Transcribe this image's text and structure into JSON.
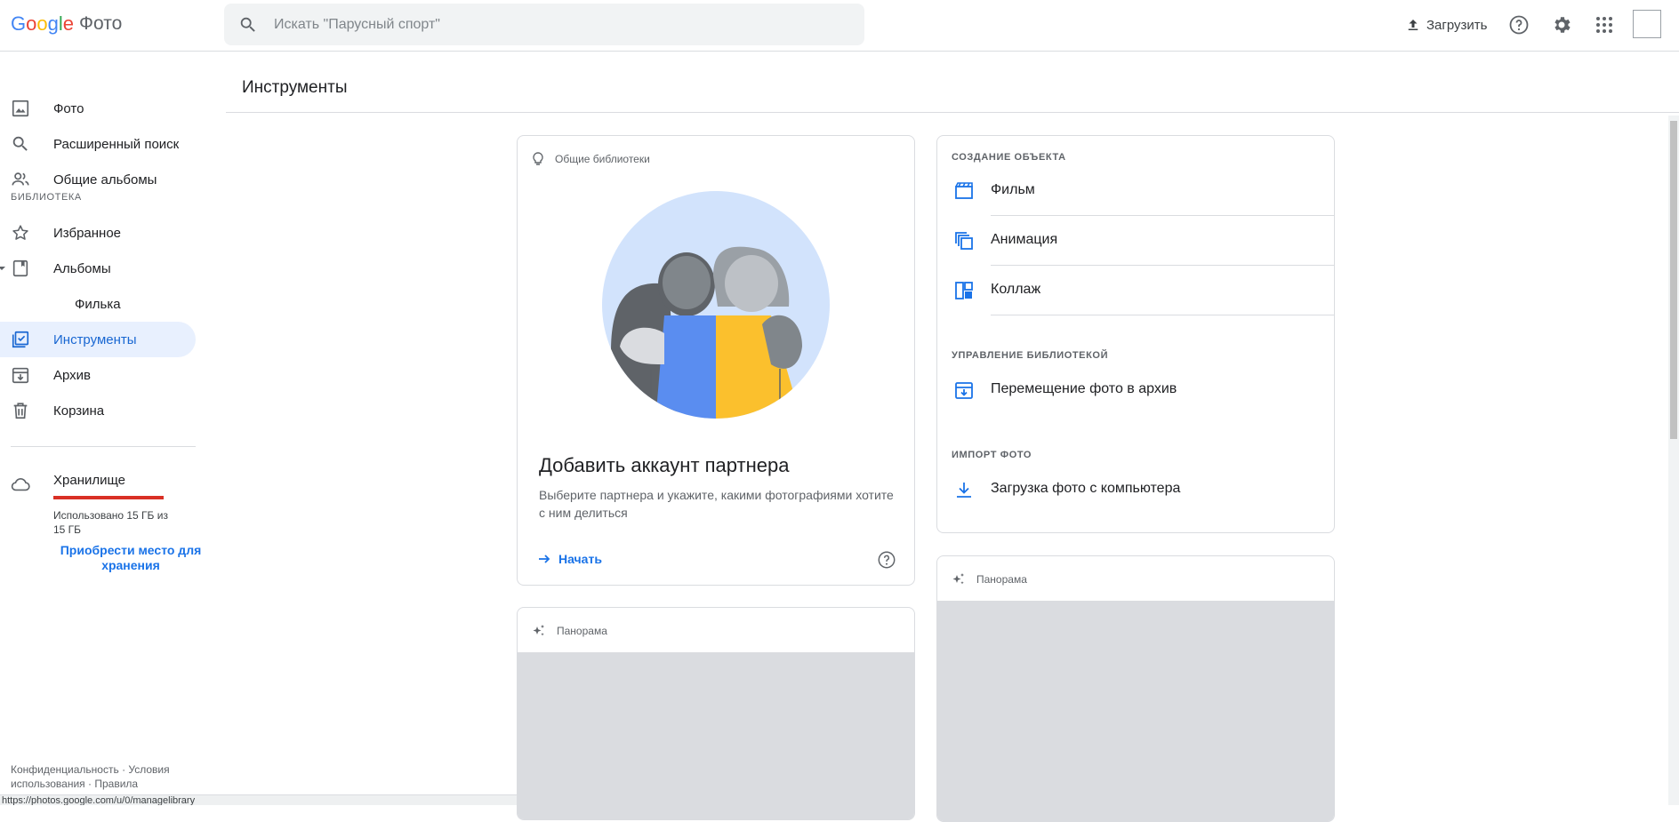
{
  "header": {
    "logo_google": "Google",
    "logo_product": "Фото",
    "search_placeholder": "Искать \"Парусный спорт\"",
    "upload_label": "Загрузить"
  },
  "sidebar": {
    "items": [
      {
        "label": "Фото",
        "icon": "photo-icon"
      },
      {
        "label": "Расширенный поиск",
        "icon": "search-icon"
      },
      {
        "label": "Общие альбомы",
        "icon": "people-icon"
      }
    ],
    "library_heading": "БИБЛИОТЕКА",
    "library_items": [
      {
        "label": "Избранное",
        "icon": "star-icon"
      },
      {
        "label": "Альбомы",
        "icon": "album-icon"
      },
      {
        "label": "Филька"
      },
      {
        "label": "Инструменты",
        "icon": "tools-icon",
        "active": true
      },
      {
        "label": "Архив",
        "icon": "archive-icon"
      },
      {
        "label": "Корзина",
        "icon": "trash-icon"
      }
    ],
    "storage": {
      "title": "Хранилище",
      "used": "Использовано 15 ГБ из 15 ГБ",
      "buy": "Приобрести место для хранения",
      "fill_fraction": 1.0
    },
    "footer": {
      "privacy": "Конфиденциальность",
      "sep": "·",
      "terms": "Условия использования",
      "policy": "Правила"
    }
  },
  "status_url": "https://photos.google.com/u/0/managelibrary",
  "main": {
    "title": "Инструменты",
    "partner_card": {
      "header": "Общие библиотеки",
      "title": "Добавить аккаунт партнера",
      "description": "Выберите партнера и укажите, какими фотографиями хотите с ним делиться",
      "start": "Начать"
    },
    "panorama_left": {
      "header": "Панорама"
    },
    "panorama_right": {
      "header": "Панорама"
    },
    "tools_card": {
      "create_heading": "СОЗДАНИЕ ОБЪЕКТА",
      "create_items": [
        {
          "label": "Фильм",
          "icon": "movie-icon"
        },
        {
          "label": "Анимация",
          "icon": "animation-icon"
        },
        {
          "label": "Коллаж",
          "icon": "collage-icon"
        }
      ],
      "manage_heading": "УПРАВЛЕНИЕ БИБЛИОТЕКОЙ",
      "manage_items": [
        {
          "label": "Перемещение фото в архив",
          "icon": "archive-icon"
        }
      ],
      "import_heading": "ИМПОРТ ФОТО",
      "import_items": [
        {
          "label": "Загрузка фото с компьютера",
          "icon": "download-icon"
        }
      ]
    }
  },
  "colors": {
    "accent": "#1a73e8",
    "active_bg": "#e8f0fe",
    "storage_bar": "#d93025"
  }
}
